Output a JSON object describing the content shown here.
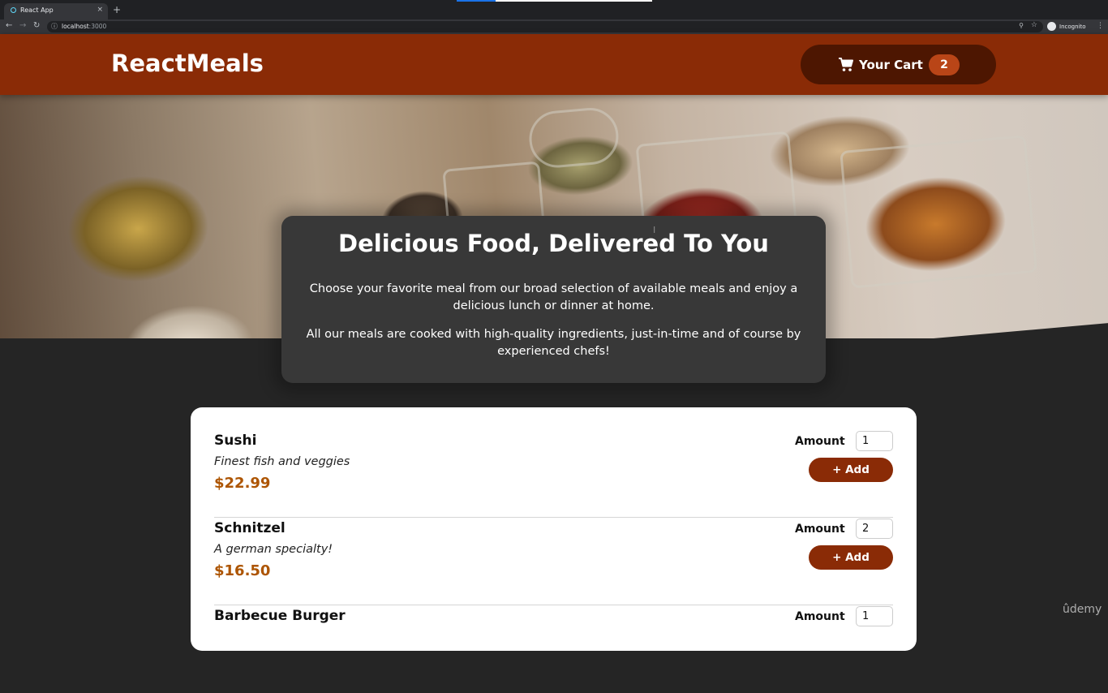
{
  "browser": {
    "tab_title": "React App",
    "tab_close": "×",
    "new_tab": "+",
    "url_host": "localhost",
    "url_port": ":3000",
    "profile_label": "Incognito"
  },
  "header": {
    "brand": "ReactMeals",
    "cart_label": "Your Cart",
    "cart_count": "2"
  },
  "summary": {
    "title": "Delicious Food, Delivered To You",
    "paragraph1": "Choose your favorite meal from our broad selection of available meals and enjoy a delicious lunch or dinner at home.",
    "paragraph2": "All our meals are cooked with high-quality ingredients, just-in-time and of course by experienced chefs!"
  },
  "meals": [
    {
      "name": "Sushi",
      "description": "Finest fish and veggies",
      "price": "$22.99",
      "amount_label": "Amount",
      "amount_value": "1",
      "add_label": "+ Add"
    },
    {
      "name": "Schnitzel",
      "description": "A german specialty!",
      "price": "$16.50",
      "amount_label": "Amount",
      "amount_value": "2",
      "add_label": "+ Add"
    },
    {
      "name": "Barbecue Burger",
      "description": "",
      "price": "",
      "amount_label": "Amount",
      "amount_value": "1",
      "add_label": ""
    }
  ],
  "watermark": "ûdemy",
  "colors": {
    "header_bg": "#8a2b06",
    "cart_bg": "#4d1601",
    "badge_bg": "#b94517",
    "price": "#ad5502",
    "page_bg": "#252525",
    "summary_bg": "#383838"
  }
}
